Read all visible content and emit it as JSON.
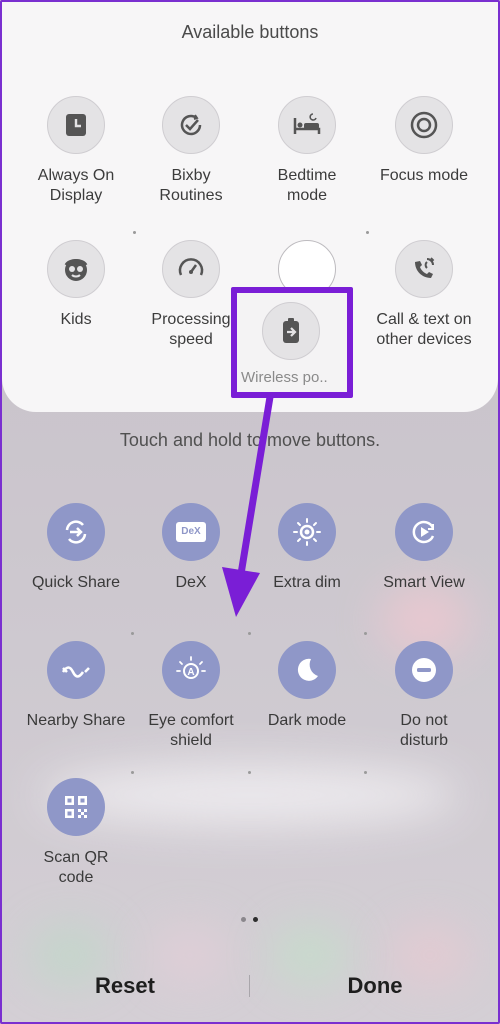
{
  "available": {
    "title": "Available buttons",
    "items": [
      {
        "label": "Always On\nDisplay",
        "icon": "clock-square-icon"
      },
      {
        "label": "Bixby\nRoutines",
        "icon": "routine-check-icon"
      },
      {
        "label": "Bedtime\nmode",
        "icon": "bed-icon"
      },
      {
        "label": "Focus mode",
        "icon": "focus-target-icon"
      },
      {
        "label": "Kids",
        "icon": "kids-face-icon"
      },
      {
        "label": "Processing\nspeed",
        "icon": "speedometer-icon"
      },
      {
        "label": "Call & text on\nother devices",
        "icon": "call-sync-icon"
      }
    ],
    "dragging": {
      "label": "Wireless po..",
      "icon": "wireless-powershare-icon"
    }
  },
  "hint": "Touch and hold to move buttons.",
  "active": {
    "items": [
      {
        "label": "Quick Share",
        "icon": "quick-share-icon"
      },
      {
        "label": "DeX",
        "icon": "dex-icon"
      },
      {
        "label": "Extra dim",
        "icon": "extra-dim-icon"
      },
      {
        "label": "Smart View",
        "icon": "smart-view-icon"
      },
      {
        "label": "Nearby Share",
        "icon": "nearby-share-icon"
      },
      {
        "label": "Eye comfort\nshield",
        "icon": "eye-comfort-icon"
      },
      {
        "label": "Dark mode",
        "icon": "moon-icon"
      },
      {
        "label": "Do not\ndisturb",
        "icon": "do-not-disturb-icon"
      },
      {
        "label": "Scan QR\ncode",
        "icon": "qr-code-icon"
      }
    ]
  },
  "dex_text": "DeX",
  "footer": {
    "reset": "Reset",
    "done": "Done"
  },
  "colors": {
    "accent": "#7a1ed6",
    "active_icon_bg": "#8f97c8"
  }
}
